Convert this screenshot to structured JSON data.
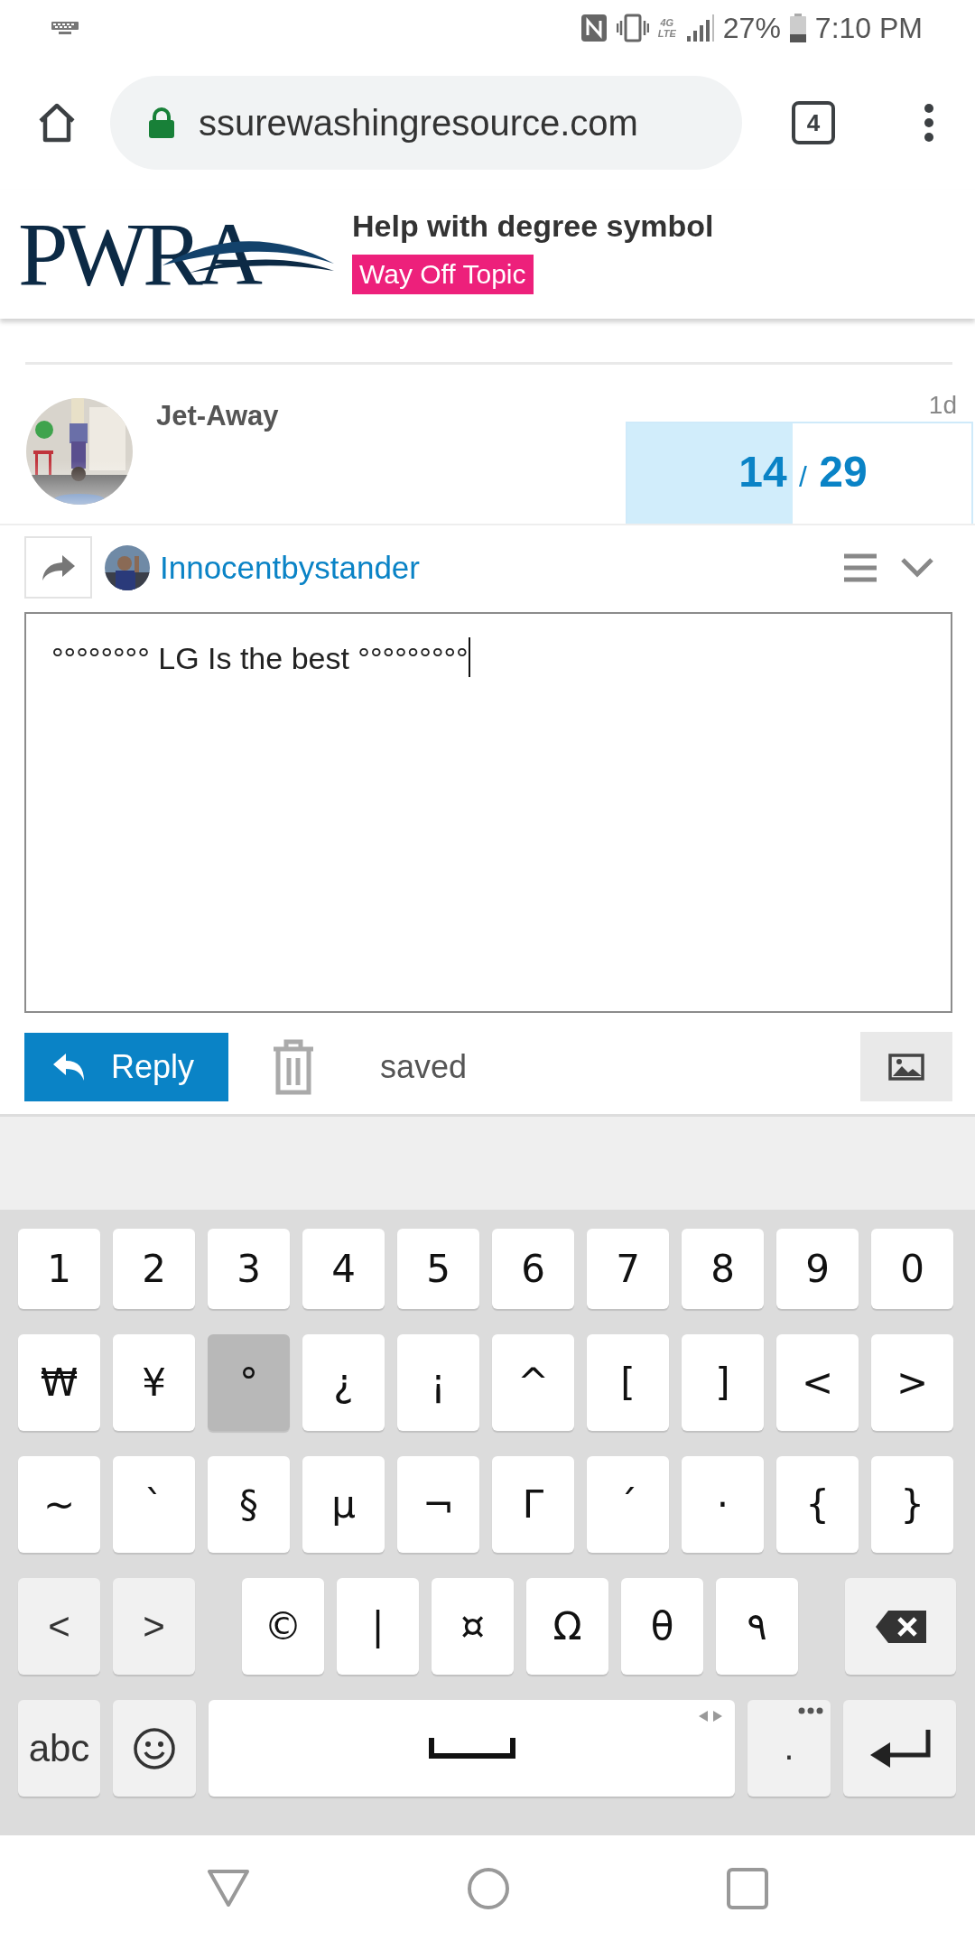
{
  "status_bar": {
    "network_top": "4G",
    "network_bottom": "LTE",
    "battery": "27%",
    "time": "7:10 PM"
  },
  "browser": {
    "url": "ssurewashingresource.com",
    "tab_count": "4"
  },
  "topic_header": {
    "logo": "PWRA",
    "title": "Help with degree symbol",
    "category": "Way Off Topic"
  },
  "post": {
    "author": "Jet-Away",
    "age": "1d"
  },
  "progress": {
    "current": "14",
    "separator": "/",
    "total": "29",
    "level": 0.48
  },
  "composer": {
    "reply_to": "Innocentbystander",
    "text": "°°°°°°°° LG Is the best °°°°°°°°°",
    "reply_button": "Reply",
    "status": "saved"
  },
  "keyboard": {
    "rows": [
      [
        {
          "kind": "char",
          "label": "1",
          "selected": false
        },
        {
          "kind": "char",
          "label": "2",
          "selected": false
        },
        {
          "kind": "char",
          "label": "3",
          "selected": false
        },
        {
          "kind": "char",
          "label": "4",
          "selected": false
        },
        {
          "kind": "char",
          "label": "5",
          "selected": false
        },
        {
          "kind": "char",
          "label": "6",
          "selected": false
        },
        {
          "kind": "char",
          "label": "7",
          "selected": false
        },
        {
          "kind": "char",
          "label": "8",
          "selected": false
        },
        {
          "kind": "char",
          "label": "9",
          "selected": false
        },
        {
          "kind": "char",
          "label": "0",
          "selected": false
        }
      ],
      [
        {
          "kind": "char",
          "label": "₩",
          "selected": false
        },
        {
          "kind": "char",
          "label": "¥",
          "selected": false
        },
        {
          "kind": "char",
          "label": "°",
          "selected": true
        },
        {
          "kind": "char",
          "label": "¿",
          "selected": false
        },
        {
          "kind": "char",
          "label": "¡",
          "selected": false
        },
        {
          "kind": "char",
          "label": "^",
          "selected": false
        },
        {
          "kind": "char",
          "label": "[",
          "selected": false
        },
        {
          "kind": "char",
          "label": "]",
          "selected": false
        },
        {
          "kind": "char",
          "label": "<",
          "selected": false
        },
        {
          "kind": "char",
          "label": ">",
          "selected": false
        }
      ],
      [
        {
          "kind": "char",
          "label": "~",
          "selected": false
        },
        {
          "kind": "char",
          "label": "`",
          "selected": false
        },
        {
          "kind": "char",
          "label": "§",
          "selected": false
        },
        {
          "kind": "char",
          "label": "µ",
          "selected": false
        },
        {
          "kind": "char",
          "label": "¬",
          "selected": false
        },
        {
          "kind": "char",
          "label": "Γ",
          "selected": false
        },
        {
          "kind": "char",
          "label": "´",
          "selected": false
        },
        {
          "kind": "char",
          "label": "·",
          "selected": false
        },
        {
          "kind": "char",
          "label": "{",
          "selected": false
        },
        {
          "kind": "char",
          "label": "}",
          "selected": false
        }
      ],
      [
        {
          "kind": "func",
          "label": "<",
          "selected": false
        },
        {
          "kind": "func",
          "label": ">",
          "selected": false
        },
        {
          "kind": "char",
          "label": "©",
          "selected": false
        },
        {
          "kind": "char",
          "label": "|",
          "selected": false
        },
        {
          "kind": "char",
          "label": "¤",
          "selected": false
        },
        {
          "kind": "char",
          "label": "Ω",
          "selected": false
        },
        {
          "kind": "char",
          "label": "θ",
          "selected": false
        },
        {
          "kind": "char",
          "label": "٩",
          "selected": false
        },
        {
          "kind": "backspace",
          "selected": false
        }
      ],
      [
        {
          "kind": "func",
          "label": "abc",
          "selected": false
        },
        {
          "kind": "emoji",
          "selected": false
        },
        {
          "kind": "space",
          "selected": false
        },
        {
          "kind": "period",
          "label": ".",
          "selected": false
        },
        {
          "kind": "enter",
          "selected": false
        }
      ]
    ]
  }
}
